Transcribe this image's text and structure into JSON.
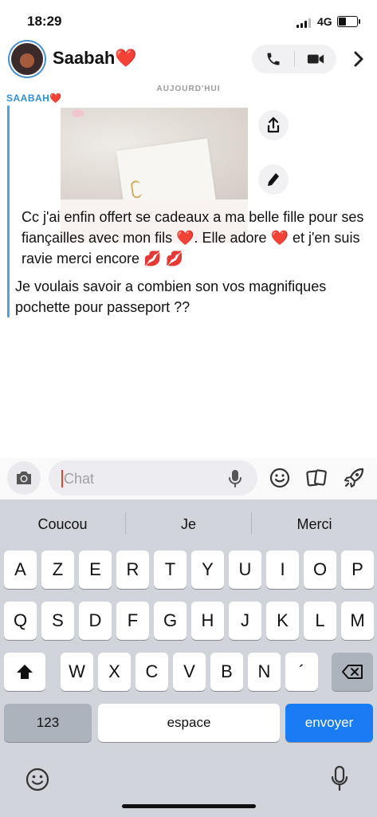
{
  "status_bar": {
    "time": "18:29",
    "network": "4G",
    "battery_level": 0.45
  },
  "header": {
    "contact_name": "Saabah❤️"
  },
  "conversation": {
    "day_label": "AUJOURD'HUI",
    "sender": "SAABAH❤️",
    "messages": [
      "Cc j'ai enfin offert se cadeaux a ma belle fille pour ses fiançailles avec mon fils ❤️. Elle adore ❤️ et j'en suis ravie merci encore 💋 💋",
      "Je voulais savoir a combien son vos magnifiques pochette pour passeport ??"
    ]
  },
  "composer": {
    "placeholder": "Chat"
  },
  "keyboard": {
    "suggestions": [
      "Coucou",
      "Je",
      "Merci"
    ],
    "row1": [
      "A",
      "Z",
      "E",
      "R",
      "T",
      "Y",
      "U",
      "I",
      "O",
      "P"
    ],
    "row2": [
      "Q",
      "S",
      "D",
      "F",
      "G",
      "H",
      "J",
      "K",
      "L",
      "M"
    ],
    "row3": [
      "W",
      "X",
      "C",
      "V",
      "B",
      "N",
      "´"
    ],
    "numbers_key": "123",
    "space_key": "espace",
    "send_key": "envoyer"
  },
  "colors": {
    "accent": "#1a7cf4",
    "sender": "#2e8fd3",
    "caret": "#e34234"
  },
  "icons": [
    "phone-icon",
    "video-icon",
    "chevron-right-icon",
    "share-icon",
    "pencil-icon",
    "camera-icon",
    "mic-icon",
    "smiley-icon",
    "cards-icon",
    "rocket-icon",
    "shift-icon",
    "backspace-icon",
    "emoji-icon",
    "dictation-icon"
  ]
}
